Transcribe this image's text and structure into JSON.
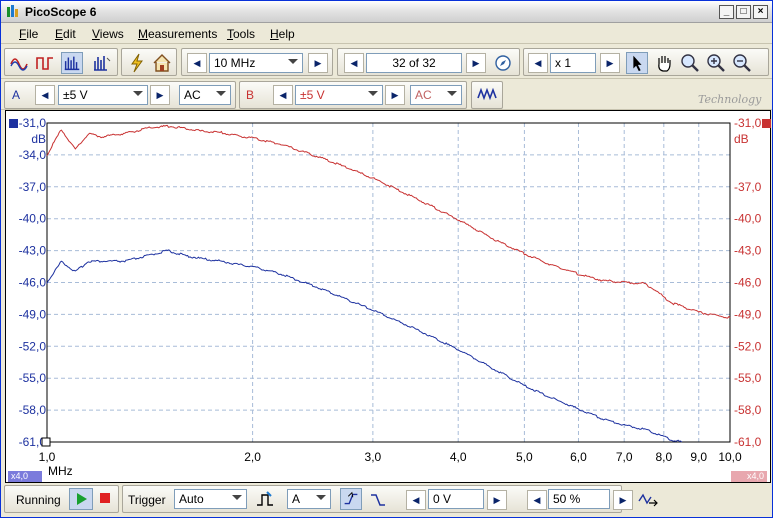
{
  "window": {
    "title": "PicoScope 6",
    "minimize": "_",
    "maximize": "□",
    "close": "×"
  },
  "menu": [
    {
      "key": "F",
      "rest": "ile"
    },
    {
      "key": "E",
      "rest": "dit"
    },
    {
      "key": "V",
      "rest": "iews"
    },
    {
      "key": "M",
      "rest": "easurements"
    },
    {
      "key": "T",
      "rest": "ools"
    },
    {
      "key": "H",
      "rest": "elp"
    }
  ],
  "toolbar": {
    "samplerate": "10 MHz",
    "buffer": "32 of 32",
    "zoom": "x 1",
    "watermark": "Technology"
  },
  "channels": {
    "a": {
      "label": "A",
      "range": "±5 V",
      "coupling": "AC",
      "color": "#1e32a0"
    },
    "b": {
      "label": "B",
      "range": "±5 V",
      "coupling": "AC",
      "color": "#c83232"
    }
  },
  "status": {
    "running": "Running",
    "trigger_label": "Trigger",
    "trigger_mode": "Auto",
    "trigger_source": "A",
    "trigger_level": "0 V",
    "pretrigger": "50 %"
  },
  "chart_data": {
    "type": "line",
    "xscale": "log",
    "xlim": [
      1.0,
      10.0
    ],
    "xlabel": "MHz",
    "ylabel_left": "dB",
    "ylabel_right": "dB",
    "ylim": [
      -61.0,
      -31.0
    ],
    "x_ticks": [
      "1,0",
      "2,0",
      "3,0",
      "4,0",
      "5,0",
      "6,0",
      "7,0",
      "8,0",
      "9,0",
      "10,0"
    ],
    "y_ticks": [
      "-31,0",
      "-34,0",
      "-37,0",
      "-40,0",
      "-43,0",
      "-46,0",
      "-49,0",
      "-52,0",
      "-55,0",
      "-58,0",
      "-61,0"
    ],
    "y_ticks_right": [
      "-31,0",
      "-37,0",
      "-40,0",
      "-43,0",
      "-46,0",
      "-49,0",
      "-52,0",
      "-55,0",
      "-58,0",
      "-61,0"
    ],
    "grid": true,
    "zoom_left": "x4,0",
    "zoom_right": "x4,0",
    "series": [
      {
        "name": "A",
        "color": "#1e32a0",
        "x": [
          1.0,
          1.05,
          1.1,
          1.15,
          1.2,
          1.3,
          1.4,
          1.5,
          1.6,
          1.7,
          1.8,
          1.9,
          2.0,
          2.2,
          2.5,
          2.8,
          3.0,
          3.5,
          4.0,
          4.5,
          5.0,
          5.5,
          6.0,
          6.5,
          7.0,
          7.5,
          7.8,
          8.2,
          8.5
        ],
        "y": [
          -46.0,
          -44.0,
          -45.0,
          -44.0,
          -44.0,
          -44.0,
          -43.5,
          -43.0,
          -43.5,
          -43.8,
          -44.0,
          -44.3,
          -44.5,
          -45.2,
          -46.5,
          -47.8,
          -48.6,
          -50.5,
          -52.3,
          -54.1,
          -55.7,
          -56.9,
          -57.9,
          -58.8,
          -59.4,
          -59.8,
          -60.2,
          -60.8,
          -61.0
        ]
      },
      {
        "name": "B",
        "color": "#c83232",
        "x": [
          1.0,
          1.05,
          1.1,
          1.15,
          1.2,
          1.3,
          1.4,
          1.5,
          1.6,
          1.7,
          1.8,
          1.9,
          2.0,
          2.2,
          2.5,
          2.8,
          3.0,
          3.5,
          4.0,
          4.5,
          5.0,
          5.5,
          6.0,
          6.5,
          7.0,
          7.5,
          7.8,
          8.2,
          9.0,
          10.0
        ],
        "y": [
          -34.0,
          -31.6,
          -33.5,
          -32.0,
          -32.3,
          -32.0,
          -31.5,
          -31.3,
          -31.5,
          -31.8,
          -31.9,
          -32.2,
          -32.4,
          -33.0,
          -34.2,
          -35.4,
          -36.2,
          -38.2,
          -40.1,
          -41.9,
          -43.3,
          -44.4,
          -45.2,
          -45.8,
          -46.0,
          -46.1,
          -46.8,
          -47.9,
          -48.8,
          -49.3
        ]
      }
    ]
  }
}
